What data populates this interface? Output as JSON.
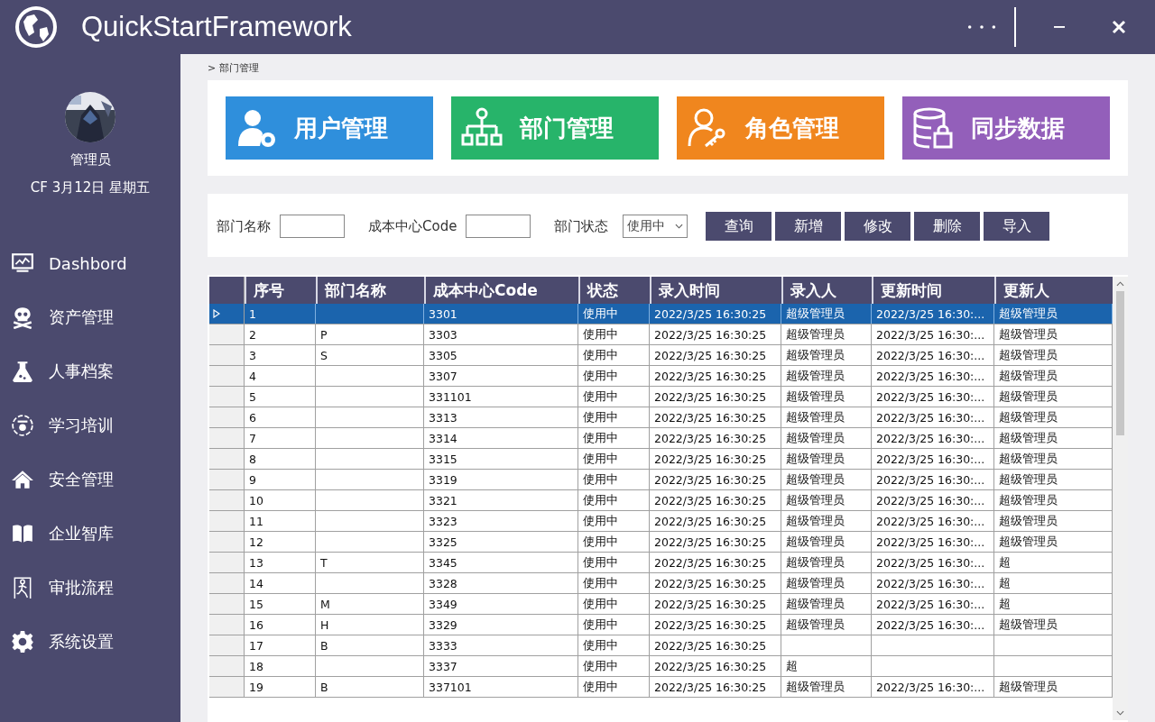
{
  "window": {
    "title": "QuickStartFramework"
  },
  "user": {
    "name": "管理员",
    "date_line": "CF 3月12日 星期五"
  },
  "sidebar": {
    "items": [
      {
        "label": "Dashbord"
      },
      {
        "label": "资产管理"
      },
      {
        "label": "人事档案"
      },
      {
        "label": "学习培训"
      },
      {
        "label": "安全管理"
      },
      {
        "label": "企业智库"
      },
      {
        "label": "审批流程"
      },
      {
        "label": "系统设置"
      }
    ]
  },
  "breadcrumb": "> 部门管理",
  "tiles": [
    {
      "label": "用户管理",
      "color": "#2f8fdc"
    },
    {
      "label": "部门管理",
      "color": "#27b46a"
    },
    {
      "label": "角色管理",
      "color": "#f0861e"
    },
    {
      "label": "同步数据",
      "color": "#935fba"
    }
  ],
  "filters": {
    "name_label": "部门名称",
    "code_label": "成本中心Code",
    "status_label": "部门状态",
    "status_value": "使用中"
  },
  "buttons": [
    "查询",
    "新增",
    "修改",
    "删除",
    "导入"
  ],
  "table": {
    "columns": [
      "序号",
      "部门名称",
      "成本中心Code",
      "状态",
      "录入时间",
      "录入人",
      "更新时间",
      "更新人"
    ],
    "rows": [
      {
        "selected": true,
        "cells": [
          "1",
          null,
          "3301",
          "使用中",
          "2022/3/25 16:30:25",
          "超级管理员",
          "2022/3/25 16:30:...",
          "超级管理员"
        ]
      },
      {
        "selected": false,
        "cells": [
          "2",
          "P",
          "3303",
          "使用中",
          "2022/3/25 16:30:25",
          "超级管理员",
          "2022/3/25 16:30:...",
          "超级管理员"
        ]
      },
      {
        "selected": false,
        "cells": [
          "3",
          "S",
          "3305",
          "使用中",
          "2022/3/25 16:30:25",
          "超级管理员",
          "2022/3/25 16:30:...",
          "超级管理员"
        ]
      },
      {
        "selected": false,
        "cells": [
          "4",
          null,
          "3307",
          "使用中",
          "2022/3/25 16:30:25",
          "超级管理员",
          "2022/3/25 16:30:...",
          "超级管理员"
        ]
      },
      {
        "selected": false,
        "cells": [
          "5",
          null,
          "331101",
          "使用中",
          "2022/3/25 16:30:25",
          "超级管理员",
          "2022/3/25 16:30:...",
          "超级管理员"
        ]
      },
      {
        "selected": false,
        "cells": [
          "6",
          null,
          "3313",
          "使用中",
          "2022/3/25 16:30:25",
          "超级管理员",
          "2022/3/25 16:30:...",
          "超级管理员"
        ]
      },
      {
        "selected": false,
        "cells": [
          "7",
          null,
          "3314",
          "使用中",
          "2022/3/25 16:30:25",
          "超级管理员",
          "2022/3/25 16:30:...",
          "超级管理员"
        ]
      },
      {
        "selected": false,
        "cells": [
          "8",
          null,
          "3315",
          "使用中",
          "2022/3/25 16:30:25",
          "超级管理员",
          "2022/3/25 16:30:...",
          "超级管理员"
        ]
      },
      {
        "selected": false,
        "cells": [
          "9",
          null,
          "3319",
          "使用中",
          "2022/3/25 16:30:25",
          "超级管理员",
          "2022/3/25 16:30:...",
          "超级管理员"
        ]
      },
      {
        "selected": false,
        "cells": [
          "10",
          null,
          "3321",
          "使用中",
          "2022/3/25 16:30:25",
          "超级管理员",
          "2022/3/25 16:30:...",
          "超级管理员"
        ]
      },
      {
        "selected": false,
        "cells": [
          "11",
          null,
          "3323",
          "使用中",
          "2022/3/25 16:30:25",
          "超级管理员",
          "2022/3/25 16:30:...",
          "超级管理员"
        ]
      },
      {
        "selected": false,
        "cells": [
          "12",
          null,
          "3325",
          "使用中",
          "2022/3/25 16:30:25",
          "超级管理员",
          "2022/3/25 16:30:...",
          "超级管理员"
        ]
      },
      {
        "selected": false,
        "cells": [
          "13",
          "T",
          "3345",
          "使用中",
          "2022/3/25 16:30:25",
          "超级管理员",
          "2022/3/25 16:30:...",
          "超"
        ]
      },
      {
        "selected": false,
        "cells": [
          "14",
          null,
          "3328",
          "使用中",
          "2022/3/25 16:30:25",
          "超级管理员",
          "2022/3/25 16:30:...",
          "超"
        ]
      },
      {
        "selected": false,
        "cells": [
          "15",
          "M",
          "3349",
          "使用中",
          "2022/3/25 16:30:25",
          "超级管理员",
          "2022/3/25 16:30:...",
          "超"
        ]
      },
      {
        "selected": false,
        "cells": [
          "16",
          "H",
          "3329",
          "使用中",
          "2022/3/25 16:30:25",
          "超级管理员",
          "2022/3/25 16:30:...",
          "超级管理员"
        ]
      },
      {
        "selected": false,
        "cells": [
          "17",
          "B",
          "3333",
          "使用中",
          "2022/3/25 16:30:25",
          null,
          null,
          null
        ]
      },
      {
        "selected": false,
        "cells": [
          "18",
          null,
          "3337",
          "使用中",
          "2022/3/25 16:30:25",
          "超",
          null,
          null
        ]
      },
      {
        "selected": false,
        "cells": [
          "19",
          "B",
          "337101",
          "使用中",
          "2022/3/25 16:30:25",
          "超级管理员",
          "2022/3/25 16:30:...",
          "超级管理员"
        ]
      }
    ]
  }
}
